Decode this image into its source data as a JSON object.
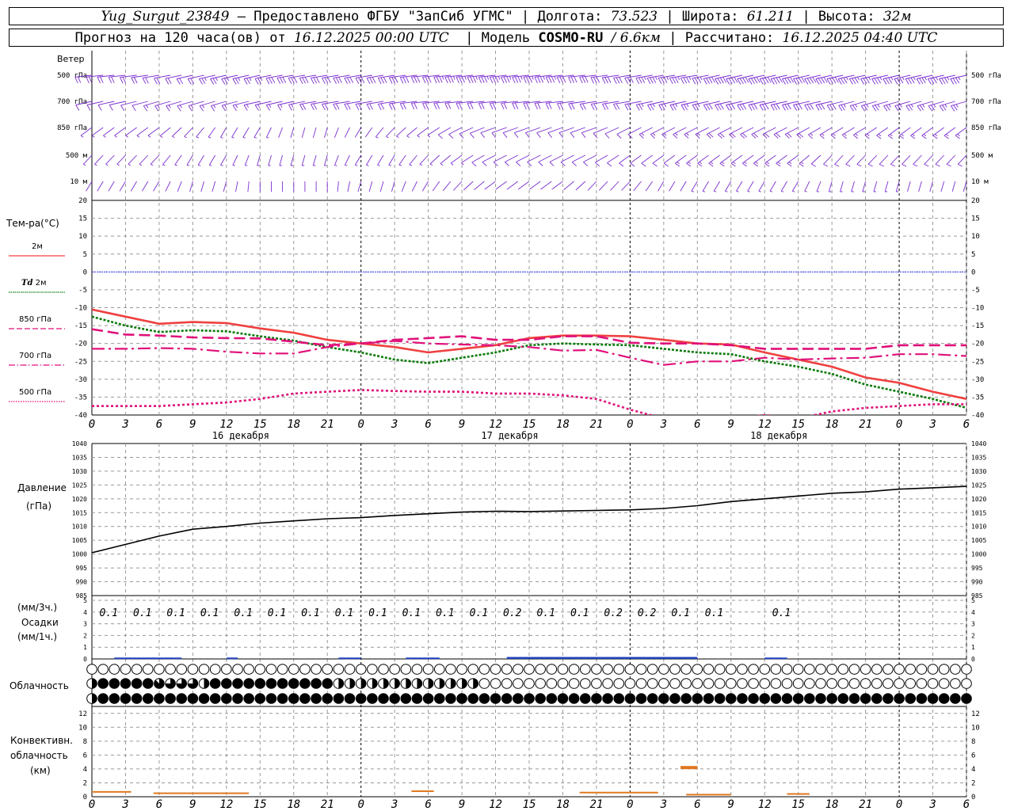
{
  "header": {
    "station": "Yug_Surgut_23849",
    "dash": "–",
    "provider": "Предоставлено ФГБУ \"ЗапСиб УГМС\"",
    "lon_label": "Долгота:",
    "lon_value": "73.523",
    "lat_label": "Широта:",
    "lat_value": "61.211",
    "alt_label": "Высота:",
    "alt_value": "32м",
    "forecast_label": "Прогноз на 120 часа(ов) от",
    "forecast_from": "16.12.2025 00:00 UTC",
    "model_label": "Модель",
    "model_name": "COSMO-RU",
    "model_res": "/ 6.6км",
    "calc_label": "Рассчитано:",
    "calc_time": "16.12.2025 04:40 UTC"
  },
  "labels": {
    "wind": "Ветер",
    "levels": [
      "500 гПа",
      "700 гПа",
      "850 гПа",
      "500 м",
      "10 м"
    ],
    "temp_title": "Тем-ра(°С)",
    "t2m": "2м",
    "td_td": "Td",
    "td_2m": "2м",
    "t850": "850 гПа",
    "t700": "700 гПа",
    "t500": "500 гПа",
    "pressure": "Давление",
    "pressure_unit": "(гПа)",
    "precip_3h": "(мм/3ч.)",
    "precip": "Осадки",
    "precip_1h": "(мм/1ч.)",
    "cloud": "Облачность",
    "conv1": "Конвективн.",
    "conv2": "облачность",
    "conv3": "(км)"
  },
  "colors": {
    "t2m": "#f04040",
    "td2m": "#0a7a0a",
    "t850": "#e0107a",
    "t700": "#e0107a",
    "t500": "#e0107a",
    "zero_line": "#4040ff",
    "wind": "#7b2fd0",
    "pressure": "#000000",
    "precip": "#2040c0",
    "conv": "#e07820"
  },
  "chart_data": [
    {
      "type": "line",
      "panel": "temperature",
      "x_hours": [
        0,
        3,
        6,
        9,
        12,
        15,
        18,
        21,
        24,
        27,
        30,
        33,
        36,
        39,
        42,
        45,
        48,
        51,
        54,
        57,
        60,
        63,
        66,
        69,
        72,
        75,
        78
      ],
      "x_ticks": [
        "0",
        "3",
        "6",
        "9",
        "12",
        "15",
        "18",
        "21",
        "0",
        "3",
        "6",
        "9",
        "12",
        "15",
        "18",
        "21",
        "0",
        "3",
        "6",
        "9",
        "12",
        "15",
        "18",
        "21",
        "0",
        "3",
        "6"
      ],
      "date_labels": [
        {
          "hour": 12,
          "text": "16 декабря"
        },
        {
          "hour": 36,
          "text": "17 декабря"
        },
        {
          "hour": 60,
          "text": "18 декабря"
        }
      ],
      "ylim": [
        -40,
        20
      ],
      "y_ticks": [
        20,
        15,
        10,
        5,
        0,
        -5,
        -10,
        -15,
        -20,
        -25,
        -30,
        -35,
        -40
      ],
      "series": [
        {
          "name": "2м",
          "key": "t2m",
          "values": [
            -10.5,
            -12.5,
            -14.5,
            -14,
            -14.3,
            -15.8,
            -17,
            -19,
            -20,
            -21,
            -22.5,
            -21.5,
            -20.5,
            -18.5,
            -17.8,
            -17.8,
            -18,
            -19,
            -20,
            -20.3,
            -22.5,
            -24.5,
            -26.5,
            -29.5,
            -31,
            -33.5,
            -35.5
          ]
        },
        {
          "name": "Td 2м",
          "key": "td2m",
          "values": [
            -12.5,
            -15,
            -16.8,
            -16.3,
            -16.6,
            -18,
            -19.2,
            -21,
            -22.5,
            -24.5,
            -25.5,
            -24,
            -22.5,
            -20.5,
            -20,
            -20.3,
            -20.5,
            -21.5,
            -22.5,
            -23,
            -25,
            -26.5,
            -28.5,
            -31.5,
            -33.5,
            -35.5,
            -38
          ]
        },
        {
          "name": "850 гПа",
          "key": "t850",
          "values": [
            -16,
            -17.5,
            -17.8,
            -18.3,
            -18.5,
            -18.6,
            -19.5,
            -20.5,
            -20,
            -19,
            -18.5,
            -18,
            -19,
            -19,
            -18,
            -18,
            -19.8,
            -20,
            -20,
            -20.5,
            -21.5,
            -21.5,
            -21.5,
            -21.5,
            -20.5,
            -20.5,
            -20.5
          ]
        },
        {
          "name": "700 гПа",
          "key": "t700",
          "values": [
            -21.5,
            -21.5,
            -21.3,
            -21.5,
            -22.3,
            -22.8,
            -22.8,
            -21,
            -20,
            -19.3,
            -20,
            -20.3,
            -20.5,
            -21,
            -22,
            -21.8,
            -24,
            -26,
            -25,
            -25,
            -24,
            -24.5,
            -24.2,
            -24,
            -23,
            -23,
            -23.5
          ]
        },
        {
          "name": "500 гПа",
          "key": "t500",
          "values": [
            -37.5,
            -37.5,
            -37.5,
            -37,
            -36.5,
            -35.5,
            -34,
            -33.5,
            -33,
            -33.3,
            -33.5,
            -33.5,
            -34,
            -34,
            -34.5,
            -35.5,
            -38.5,
            -41,
            -41,
            -41,
            -40,
            -41,
            -39,
            -38,
            -37.5,
            -37,
            -37
          ]
        }
      ],
      "reference_line": 0
    },
    {
      "type": "line",
      "panel": "pressure",
      "x_hours": [
        0,
        3,
        6,
        9,
        12,
        15,
        18,
        21,
        24,
        27,
        30,
        33,
        36,
        39,
        42,
        45,
        48,
        51,
        54,
        57,
        60,
        63,
        66,
        69,
        72,
        75,
        78
      ],
      "ylim": [
        985,
        1040
      ],
      "y_ticks": [
        1040,
        1035,
        1030,
        1025,
        1020,
        1015,
        1010,
        1005,
        1000,
        995,
        990,
        985
      ],
      "series": [
        {
          "name": "Давление",
          "key": "pressure",
          "values": [
            1000.5,
            1003.5,
            1006.5,
            1009,
            1010,
            1011.2,
            1012,
            1012.8,
            1013.2,
            1014,
            1014.6,
            1015.2,
            1015.5,
            1015.4,
            1015.6,
            1015.8,
            1016,
            1016.5,
            1017.5,
            1019,
            1020,
            1021,
            1022,
            1022.5,
            1023.5,
            1024,
            1024.5
          ]
        }
      ]
    },
    {
      "type": "bar",
      "panel": "precipitation",
      "ylim": [
        0,
        5
      ],
      "y_ticks": [
        5,
        4,
        3,
        2,
        1,
        0
      ],
      "labels_3h": [
        {
          "hour": 1.5,
          "text": "0.1"
        },
        {
          "hour": 4.5,
          "text": "0.1"
        },
        {
          "hour": 7.5,
          "text": "0.1"
        },
        {
          "hour": 10.5,
          "text": "0.1"
        },
        {
          "hour": 13.5,
          "text": "0.1"
        },
        {
          "hour": 16.5,
          "text": "0.1"
        },
        {
          "hour": 19.5,
          "text": "0.1"
        },
        {
          "hour": 22.5,
          "text": "0.1"
        },
        {
          "hour": 25.5,
          "text": "0.1"
        },
        {
          "hour": 28.5,
          "text": "0.1"
        },
        {
          "hour": 31.5,
          "text": "0.1"
        },
        {
          "hour": 34.5,
          "text": "0.1"
        },
        {
          "hour": 37.5,
          "text": "0.2"
        },
        {
          "hour": 40.5,
          "text": "0.1"
        },
        {
          "hour": 43.5,
          "text": "0.1"
        },
        {
          "hour": 46.5,
          "text": "0.2"
        },
        {
          "hour": 49.5,
          "text": "0.2"
        },
        {
          "hour": 52.5,
          "text": "0.1"
        },
        {
          "hour": 55.5,
          "text": "0.1"
        },
        {
          "hour": 61.5,
          "text": "0.1"
        }
      ],
      "bars_1h": [
        {
          "from": 2,
          "to": 8,
          "value": 0.05
        },
        {
          "from": 12,
          "to": 13,
          "value": 0.05
        },
        {
          "from": 22,
          "to": 24,
          "value": 0.05
        },
        {
          "from": 28,
          "to": 31,
          "value": 0.05
        },
        {
          "from": 37,
          "to": 54,
          "value": 0.1
        },
        {
          "from": 60,
          "to": 62,
          "value": 0.05
        }
      ]
    },
    {
      "type": "table",
      "panel": "cloudiness",
      "rows": [
        "high",
        "middle",
        "low"
      ],
      "oktas": {
        "high": [
          0,
          0,
          0,
          0,
          0,
          0,
          0,
          0,
          0,
          0,
          0,
          0,
          0,
          0,
          0,
          0,
          0,
          0,
          0,
          0,
          0,
          0,
          0,
          0,
          0,
          0,
          0,
          0,
          0,
          0,
          0,
          0,
          0,
          0,
          0,
          0,
          0,
          0,
          0,
          0,
          0,
          0,
          0,
          0,
          0,
          0,
          0,
          0,
          0,
          0,
          0,
          0,
          0,
          0,
          0,
          0,
          0,
          0,
          0,
          0,
          0,
          0,
          0,
          0,
          0,
          0,
          0,
          0,
          0,
          0,
          0,
          0,
          0,
          0,
          0,
          0,
          0,
          0,
          0
        ],
        "middle": [
          4,
          8,
          8,
          8,
          8,
          8,
          7,
          6,
          6,
          6,
          4,
          8,
          8,
          8,
          8,
          8,
          8,
          8,
          8,
          8,
          8,
          8,
          4,
          4,
          4,
          4,
          4,
          4,
          4,
          4,
          4,
          4,
          4,
          4,
          4,
          0,
          0,
          0,
          0,
          0,
          0,
          0,
          0,
          0,
          0,
          0,
          0,
          0,
          0,
          0,
          0,
          0,
          0,
          0,
          0,
          0,
          0,
          0,
          0,
          0,
          0,
          0,
          0,
          0,
          0,
          0,
          0,
          0,
          0,
          0,
          0,
          0,
          0,
          0,
          0,
          0,
          0,
          0,
          0
        ],
        "low": [
          4,
          8,
          8,
          8,
          8,
          8,
          8,
          8,
          8,
          8,
          8,
          8,
          8,
          8,
          8,
          8,
          8,
          8,
          8,
          8,
          8,
          8,
          8,
          8,
          8,
          8,
          8,
          8,
          8,
          8,
          8,
          8,
          8,
          8,
          8,
          8,
          8,
          8,
          8,
          8,
          8,
          8,
          8,
          8,
          8,
          8,
          8,
          8,
          8,
          8,
          8,
          8,
          8,
          8,
          8,
          8,
          8,
          8,
          8,
          8,
          8,
          8,
          8,
          8,
          8,
          8,
          8,
          8,
          8,
          8,
          8,
          8,
          8,
          8,
          8,
          8,
          8,
          8,
          8
        ]
      }
    },
    {
      "type": "bar",
      "panel": "convective",
      "ylim": [
        0,
        13
      ],
      "y_ticks": [
        12,
        10,
        8,
        6,
        4,
        2,
        0
      ],
      "segments": [
        {
          "from": 0,
          "to": 3.5,
          "value": 0.7
        },
        {
          "from": 5.5,
          "to": 14,
          "value": 0.5
        },
        {
          "from": 28.5,
          "to": 30.5,
          "value": 0.8
        },
        {
          "from": 43.5,
          "to": 50.5,
          "value": 0.6
        },
        {
          "from": 52.5,
          "to": 54,
          "value": 4.2
        },
        {
          "from": 53,
          "to": 57,
          "value": 0.3
        },
        {
          "from": 62,
          "to": 64,
          "value": 0.4
        }
      ]
    },
    {
      "type": "scatter",
      "panel": "wind",
      "levels": [
        "500 гПа",
        "700 гПа",
        "850 гПа",
        "500 м",
        "10 м"
      ],
      "speed_ms": {
        "500 гПа": [
          20,
          22,
          22,
          24,
          26,
          28,
          30,
          30,
          32,
          34,
          34,
          36,
          36,
          36,
          35,
          34,
          34,
          36,
          38,
          40,
          40,
          40,
          40,
          38,
          38,
          38,
          36
        ],
        "700 гПа": [
          14,
          14,
          15,
          16,
          16,
          17,
          18,
          20,
          22,
          22,
          24,
          24,
          24,
          24,
          22,
          22,
          24,
          26,
          28,
          30,
          30,
          30,
          30,
          28,
          28,
          28,
          26
        ],
        "850 гПа": [
          6,
          8,
          8,
          8,
          8,
          6,
          4,
          4,
          4,
          6,
          8,
          10,
          12,
          14,
          14,
          14,
          14,
          16,
          18,
          20,
          20,
          20,
          18,
          18,
          16,
          16,
          16
        ],
        "500 м": [
          8,
          8,
          8,
          8,
          8,
          6,
          6,
          6,
          6,
          6,
          8,
          8,
          10,
          10,
          10,
          12,
          12,
          14,
          16,
          16,
          16,
          16,
          14,
          14,
          14,
          12,
          12
        ],
        "10 м": [
          3,
          3,
          3,
          3,
          3,
          2,
          2,
          2,
          2,
          3,
          3,
          3,
          4,
          4,
          4,
          4,
          4,
          4,
          5,
          5,
          5,
          5,
          5,
          5,
          5,
          4,
          4
        ]
      },
      "direction_deg": {
        "500 гПа": [
          260,
          260,
          255,
          250,
          250,
          250,
          255,
          255,
          255,
          255,
          260,
          260,
          260,
          260,
          260,
          260,
          255,
          255,
          255,
          250,
          250,
          250,
          250,
          250,
          250,
          250,
          250
        ],
        "700 гПа": [
          250,
          250,
          245,
          245,
          245,
          250,
          250,
          255,
          255,
          255,
          260,
          260,
          260,
          260,
          260,
          255,
          255,
          250,
          250,
          250,
          250,
          250,
          250,
          245,
          245,
          245,
          245
        ],
        "850 гПа": [
          220,
          220,
          220,
          210,
          200,
          200,
          190,
          190,
          200,
          210,
          220,
          230,
          240,
          240,
          240,
          240,
          230,
          230,
          230,
          230,
          230,
          230,
          225,
          225,
          220,
          220,
          220
        ],
        "500 м": [
          210,
          210,
          210,
          200,
          200,
          190,
          190,
          190,
          200,
          200,
          210,
          220,
          230,
          230,
          230,
          230,
          220,
          220,
          220,
          220,
          220,
          220,
          210,
          210,
          210,
          210,
          210
        ],
        "10 м": [
          200,
          200,
          200,
          190,
          190,
          180,
          180,
          180,
          190,
          190,
          200,
          210,
          220,
          220,
          220,
          210,
          210,
          200,
          200,
          200,
          200,
          200,
          190,
          190,
          190,
          190,
          190
        ]
      }
    }
  ]
}
